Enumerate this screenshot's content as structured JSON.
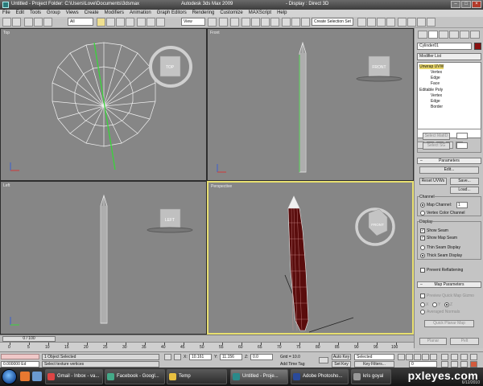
{
  "window": {
    "title": "Untitled    - Project Folder: C:\\Users\\Love\\Documents\\3dsmax",
    "app_name": "Autodesk 3ds Max  2009",
    "display_mode": "- Display : Direct 3D"
  },
  "menu": [
    "File",
    "Edit",
    "Tools",
    "Group",
    "Views",
    "Create",
    "Modifiers",
    "Animation",
    "Graph Editors",
    "Rendering",
    "Customize",
    "MAXScript",
    "Help"
  ],
  "toolbar": {
    "filter": "All",
    "coord_system": "View",
    "selection_set": "Create Selection Set"
  },
  "viewports": {
    "top": {
      "label": "Top",
      "cube_label": "TOP"
    },
    "front": {
      "label": "Front",
      "cube_label": "FRONT"
    },
    "left": {
      "label": "Left",
      "cube_label": "LEFT"
    },
    "perspective": {
      "label": "Perspective",
      "cube_label": "FRONT"
    }
  },
  "command_panel": {
    "object_name": "Cylinder01",
    "modifier_list": "Modifier List",
    "stack": [
      {
        "label": "Unwrap UVW",
        "level": 0
      },
      {
        "label": "Vertex",
        "level": 1
      },
      {
        "label": "Edge",
        "level": 1
      },
      {
        "label": "Face",
        "level": 1
      },
      {
        "label": "Editable Poly",
        "level": 0
      },
      {
        "label": "Vertex",
        "level": 1
      },
      {
        "label": "Edge",
        "level": 1
      },
      {
        "label": "Border",
        "level": 1
      }
    ],
    "select_matid": "Select MatID",
    "select_sg": "Select SG",
    "parameters": {
      "rollout": "Parameters",
      "edit": "Edit...",
      "reset_uvws": "Reset UVWs",
      "save": "Save...",
      "load": "Load...",
      "channel_label": "Channel",
      "map_channel": "Map Channel:",
      "map_channel_value": "1",
      "vertex_color_channel": "Vertex Color Channel",
      "display_label": "Display",
      "show_seam": "Show Seam",
      "show_map_seam": "Show Map Seam",
      "thin_seam": "Thin Seam Display",
      "thick_seam": "Thick Seam Display",
      "prevent_reflattening": "Prevent Reflattening"
    },
    "map_parameters": {
      "rollout": "Map Parameters",
      "preview_quick_map": "Preview Quick Map Gizmo",
      "axis_x": "X",
      "axis_y": "Y",
      "axis_z": "Z",
      "averaged_normals": "Averaged Normals",
      "quick_planar_map": "Quick Planar Map",
      "planar": "Planar",
      "pelt": "Pelt"
    }
  },
  "timeline": {
    "slider": "0 / 100",
    "ticks": [
      "0",
      "5",
      "10",
      "15",
      "20",
      "25",
      "30",
      "35",
      "40",
      "45",
      "50",
      "55",
      "60",
      "65",
      "70",
      "75",
      "80",
      "85",
      "90",
      "95",
      "100"
    ]
  },
  "status": {
    "script_value": "0.000000 Ed",
    "selected": "1 Object Selected",
    "prompt": "Select texture vertices",
    "x_label": "X:",
    "x_value": "10.161",
    "y_label": "Y:",
    "y_value": "11.156",
    "z_label": "Z:",
    "z_value": "0.0",
    "grid": "Grid = 10.0",
    "add_time_tag": "Add Time Tag",
    "auto_key": "Auto Key",
    "set_key": "Set Key",
    "selected_dropdown": "Selected",
    "key_filters": "Key Filters...",
    "frame": "0"
  },
  "taskbar": {
    "tasks": [
      {
        "label": "Gmail - Inbox - va...",
        "color": "#d44"
      },
      {
        "label": "Facebook - Googl...",
        "color": "#4a8"
      },
      {
        "label": "Temp",
        "color": "#e8c040"
      },
      {
        "label": "Untitled    - Proje...",
        "color": "#2a8a8a"
      },
      {
        "label": "Adobe Photosho...",
        "color": "#2a4a9a"
      },
      {
        "label": "kris goyal",
        "color": "#999"
      }
    ],
    "brand": "pxleyes.com",
    "date": "6/12/2010"
  }
}
